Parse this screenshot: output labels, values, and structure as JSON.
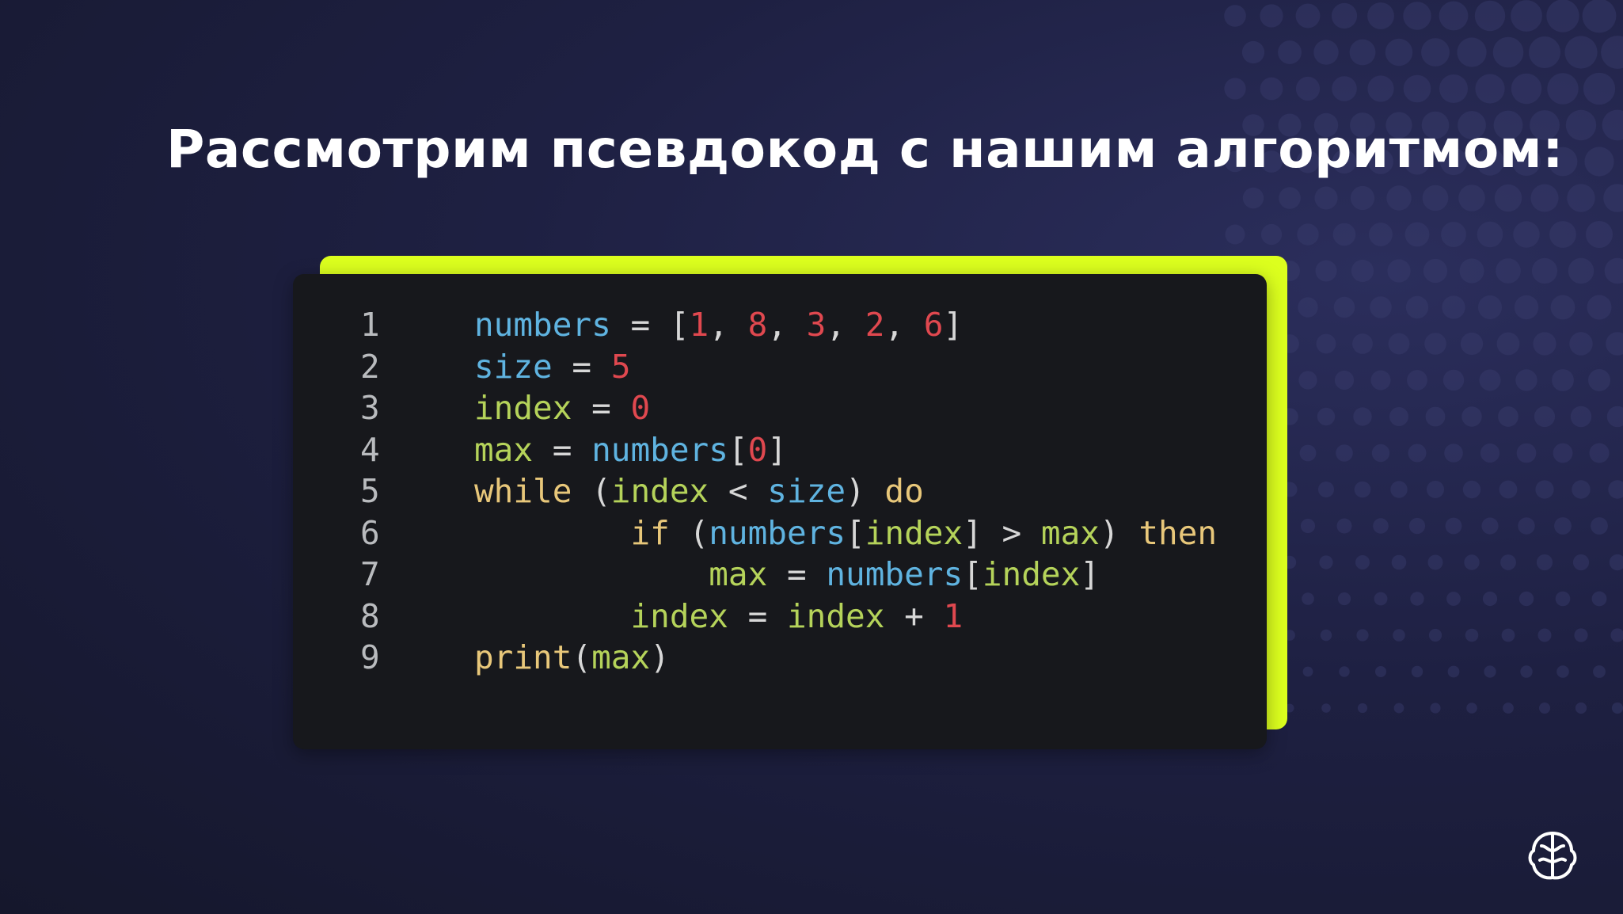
{
  "slide": {
    "title": "Рассмотрим псевдокод с нашим алгоритмом:"
  },
  "code_block": {
    "lines": [
      {
        "number": "1",
        "tokens": [
          {
            "text": "numbers",
            "kind": "var"
          },
          {
            "text": " = ",
            "kind": "op"
          },
          {
            "text": "[",
            "kind": "op"
          },
          {
            "text": "1",
            "kind": "num"
          },
          {
            "text": ", ",
            "kind": "op"
          },
          {
            "text": "8",
            "kind": "num"
          },
          {
            "text": ", ",
            "kind": "op"
          },
          {
            "text": "3",
            "kind": "num"
          },
          {
            "text": ", ",
            "kind": "op"
          },
          {
            "text": "2",
            "kind": "num"
          },
          {
            "text": ", ",
            "kind": "op"
          },
          {
            "text": "6",
            "kind": "num"
          },
          {
            "text": "]",
            "kind": "op"
          }
        ]
      },
      {
        "number": "2",
        "tokens": [
          {
            "text": "size",
            "kind": "var"
          },
          {
            "text": " = ",
            "kind": "op"
          },
          {
            "text": "5",
            "kind": "num"
          }
        ]
      },
      {
        "number": "3",
        "tokens": [
          {
            "text": "index",
            "kind": "id"
          },
          {
            "text": " = ",
            "kind": "op"
          },
          {
            "text": "0",
            "kind": "num"
          }
        ]
      },
      {
        "number": "4",
        "tokens": [
          {
            "text": "max",
            "kind": "id"
          },
          {
            "text": " = ",
            "kind": "op"
          },
          {
            "text": "numbers",
            "kind": "var"
          },
          {
            "text": "[",
            "kind": "op"
          },
          {
            "text": "0",
            "kind": "num"
          },
          {
            "text": "]",
            "kind": "op"
          }
        ]
      },
      {
        "number": "5",
        "tokens": [
          {
            "text": "while",
            "kind": "kw"
          },
          {
            "text": " (",
            "kind": "op"
          },
          {
            "text": "index",
            "kind": "id"
          },
          {
            "text": " < ",
            "kind": "op"
          },
          {
            "text": "size",
            "kind": "var"
          },
          {
            "text": ") ",
            "kind": "op"
          },
          {
            "text": "do",
            "kind": "kw"
          }
        ]
      },
      {
        "number": "6",
        "tokens": [
          {
            "text": "        ",
            "kind": "op"
          },
          {
            "text": "if",
            "kind": "kw"
          },
          {
            "text": " (",
            "kind": "op"
          },
          {
            "text": "numbers",
            "kind": "var"
          },
          {
            "text": "[",
            "kind": "op"
          },
          {
            "text": "index",
            "kind": "id"
          },
          {
            "text": "]",
            "kind": "op"
          },
          {
            "text": " > ",
            "kind": "op"
          },
          {
            "text": "max",
            "kind": "id"
          },
          {
            "text": ") ",
            "kind": "op"
          },
          {
            "text": "then",
            "kind": "kw"
          }
        ]
      },
      {
        "number": "7",
        "tokens": [
          {
            "text": "            ",
            "kind": "op"
          },
          {
            "text": "max",
            "kind": "id"
          },
          {
            "text": " = ",
            "kind": "op"
          },
          {
            "text": "numbers",
            "kind": "var"
          },
          {
            "text": "[",
            "kind": "op"
          },
          {
            "text": "index",
            "kind": "id"
          },
          {
            "text": "]",
            "kind": "op"
          }
        ]
      },
      {
        "number": "8",
        "tokens": [
          {
            "text": "        ",
            "kind": "op"
          },
          {
            "text": "index",
            "kind": "id"
          },
          {
            "text": " = ",
            "kind": "op"
          },
          {
            "text": "index",
            "kind": "id"
          },
          {
            "text": " + ",
            "kind": "op"
          },
          {
            "text": "1",
            "kind": "num"
          }
        ]
      },
      {
        "number": "9",
        "tokens": [
          {
            "text": "print",
            "kind": "kw"
          },
          {
            "text": "(",
            "kind": "op"
          },
          {
            "text": "max",
            "kind": "id"
          },
          {
            "text": ")",
            "kind": "op"
          }
        ]
      }
    ]
  },
  "colors": {
    "accent": "#dcff1e",
    "code_background": "#17181c",
    "variable": "#5fb3e0",
    "number": "#e0484f",
    "keyword": "#e8c77a",
    "identifier": "#b5d35a"
  },
  "icons": {
    "logo": "brain-icon"
  }
}
